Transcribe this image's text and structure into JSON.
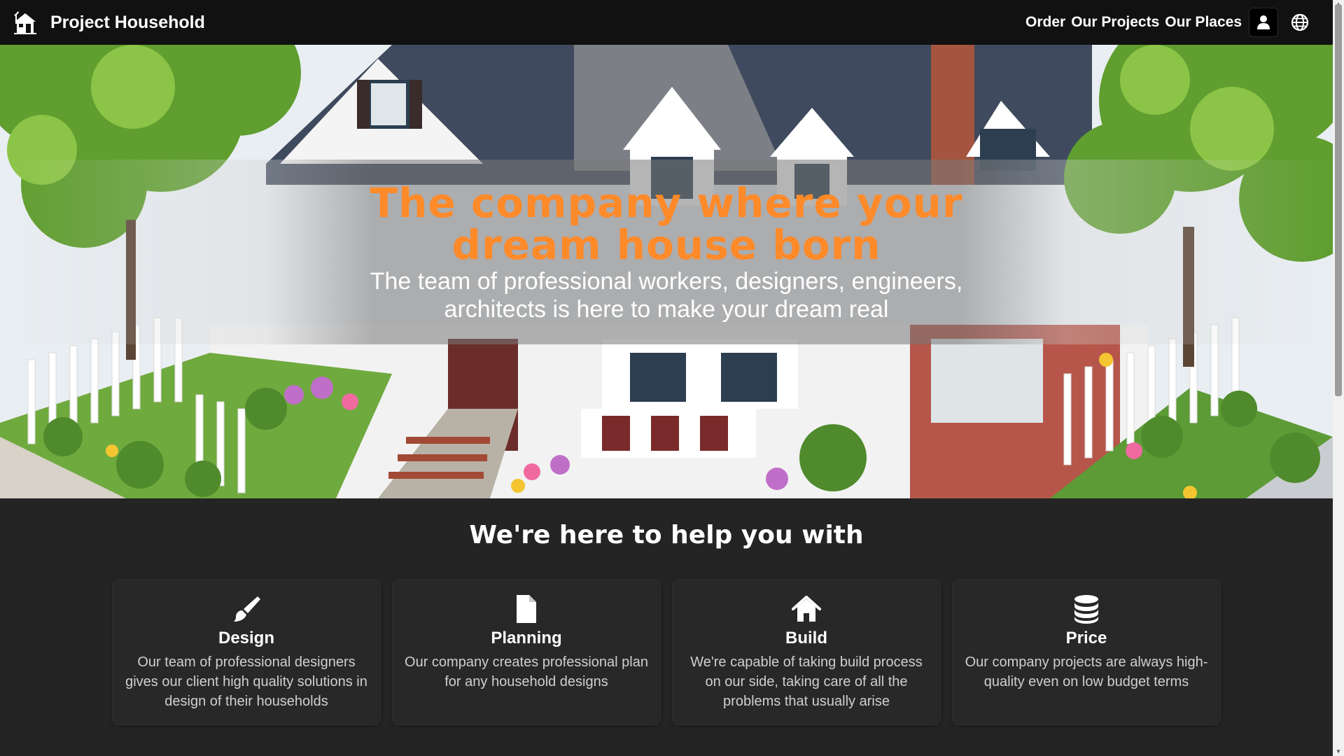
{
  "header": {
    "brand": "Project Household",
    "logo_icon": "house-logo-icon",
    "nav": [
      {
        "label": "Order"
      },
      {
        "label": "Our Projects"
      },
      {
        "label": "Our Places"
      }
    ],
    "account_icon": "user-icon",
    "language_icon": "globe-icon"
  },
  "hero": {
    "title_line1": "The company where your",
    "title_line2": "dream house born",
    "subtitle_line1": "The team of professional workers, designers, engineers,",
    "subtitle_line2": "architects is here to make your dream real",
    "title_color": "#ff8a2a"
  },
  "services": {
    "heading": "We're here to help you with",
    "cards": [
      {
        "icon": "paintbrush-icon",
        "title": "Design",
        "text": "Our team of professional designers gives our client high quality solutions in design of their households"
      },
      {
        "icon": "file-icon",
        "title": "Planning",
        "text": "Our company creates professional plan for any household designs"
      },
      {
        "icon": "house-icon",
        "title": "Build",
        "text": "We're capable of taking build process on our side, taking care of all the problems that usually arise"
      },
      {
        "icon": "database-icon",
        "title": "Price",
        "text": "Our company projects are always high-quality even on low budget terms"
      }
    ]
  },
  "colors": {
    "header_bg": "#111111",
    "page_bg": "#242424",
    "card_bg": "#282828",
    "accent": "#ff8a2a"
  }
}
